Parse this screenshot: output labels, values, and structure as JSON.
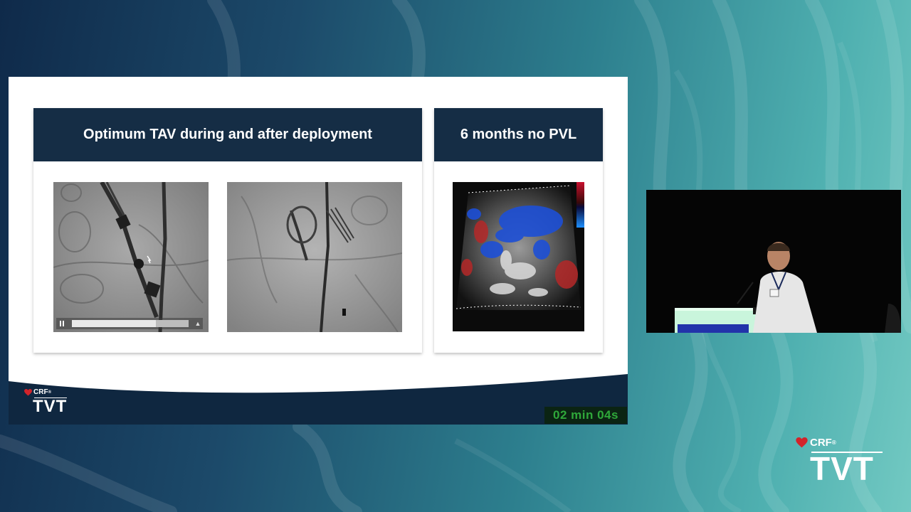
{
  "slide": {
    "left_panel": {
      "title": "Optimum TAV during and after deployment",
      "video": {
        "progress": 0.72
      }
    },
    "right_panel": {
      "title": "6 months no PVL"
    }
  },
  "slide_logo": {
    "brand": "CRF",
    "mark": "®",
    "event": "TVT"
  },
  "timer": {
    "text": "02 min 04s"
  },
  "corner_logo": {
    "brand": "CRF",
    "mark": "®",
    "event": "TVT"
  },
  "colors": {
    "panel_header": "#152d45",
    "slide_footer": "#0f2740",
    "timer_text": "#2fa83a",
    "logo_heart": "#d2232a"
  }
}
